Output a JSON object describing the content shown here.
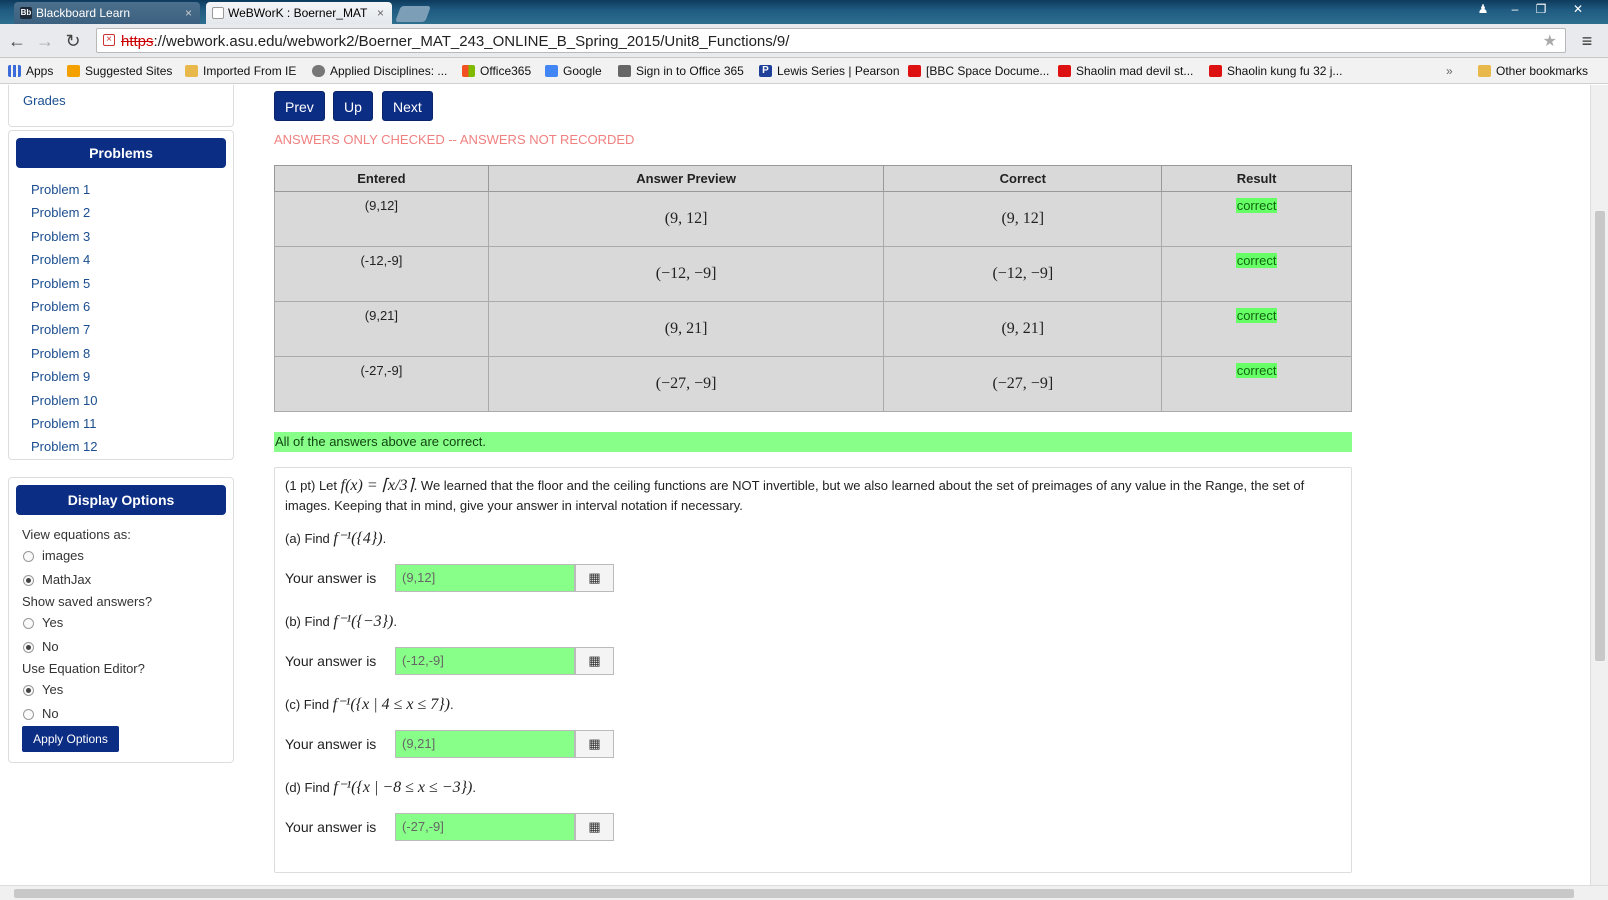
{
  "browser": {
    "tabs": [
      {
        "label": "Blackboard Learn",
        "close": "×"
      },
      {
        "label": "WeBWorK : Boerner_MAT",
        "close": "×"
      }
    ],
    "url_scheme": "https",
    "url_rest": "://webwork.asu.edu/webwork2/Boerner_MAT_243_ONLINE_B_Spring_2015/Unit8_Functions/9/",
    "bookmarks": [
      {
        "label": "Apps",
        "icon": "apps-grid-icon"
      },
      {
        "label": "Suggested Sites",
        "icon": "suggested-sites-icon"
      },
      {
        "label": "Imported From IE",
        "icon": "folder-icon"
      },
      {
        "label": "Applied Disciplines: ...",
        "icon": "site-icon"
      },
      {
        "label": "Office365",
        "icon": "office-icon"
      },
      {
        "label": "Google",
        "icon": "google-icon"
      },
      {
        "label": "Sign in to Office 365",
        "icon": "sign-in-icon"
      },
      {
        "label": "Lewis Series | Pearson",
        "icon": "pearson-icon"
      },
      {
        "label": "[BBC Space Docume...",
        "icon": "youtube-icon"
      },
      {
        "label": "Shaolin mad devil st...",
        "icon": "youtube-icon"
      },
      {
        "label": "Shaolin kung fu 32 j...",
        "icon": "youtube-icon"
      }
    ],
    "overflow": "»",
    "other_bookmarks": "Other bookmarks"
  },
  "sidebar": {
    "grades_link": "Grades",
    "problems_header": "Problems",
    "problems": [
      "Problem 1",
      "Problem 2",
      "Problem 3",
      "Problem 4",
      "Problem 5",
      "Problem 6",
      "Problem 7",
      "Problem 8",
      "Problem 9",
      "Problem 10",
      "Problem 11",
      "Problem 12"
    ],
    "display_header": "Display Options",
    "view_equations_label": "View equations as:",
    "view_opt_images": "images",
    "view_opt_mathjax": "MathJax",
    "view_selected": "MathJax",
    "show_saved_label": "Show saved answers?",
    "saved_yes": "Yes",
    "saved_no": "No",
    "saved_selected": "No",
    "eq_editor_label": "Use Equation Editor?",
    "editor_yes": "Yes",
    "editor_no": "No",
    "editor_selected": "Yes",
    "apply_button": "Apply Options"
  },
  "nav": {
    "prev": "Prev",
    "up": "Up",
    "next": "Next"
  },
  "status_message": "ANSWERS ONLY CHECKED -- ANSWERS NOT RECORDED",
  "results": {
    "headers": [
      "Entered",
      "Answer Preview",
      "Correct",
      "Result"
    ],
    "rows": [
      {
        "entered": "(9,12]",
        "preview": "(9, 12]",
        "correct": "(9, 12]",
        "result": "correct"
      },
      {
        "entered": "(-12,-9]",
        "preview": "(−12, −9]",
        "correct": "(−12, −9]",
        "result": "correct"
      },
      {
        "entered": "(9,21]",
        "preview": "(9, 21]",
        "correct": "(9, 21]",
        "result": "correct"
      },
      {
        "entered": "(-27,-9]",
        "preview": "(−27, −9]",
        "correct": "(−27, −9]",
        "result": "correct"
      }
    ]
  },
  "all_correct_message": "All of the answers above are correct.",
  "problem": {
    "intro_prefix": "(1 pt) Let",
    "intro_math": "f(x) = ⌈x/3⌉",
    "intro_text": ". We learned that the floor and the ceiling functions are NOT invertible, but we also learned about the set of preimages of any value in the Range, the set of images. Keeping that in mind, give your answer in interval notation if necessary.",
    "parts": [
      {
        "label": "(a) Find",
        "math": "f⁻¹({4})",
        "answer": "(9,12]"
      },
      {
        "label": "(b) Find",
        "math": "f⁻¹({−3})",
        "answer": "(-12,-9]"
      },
      {
        "label": "(c) Find",
        "math": "f⁻¹({x | 4 ≤ x ≤ 7})",
        "answer": "(9,21]"
      },
      {
        "label": "(d) Find",
        "math": "f⁻¹({x | −8 ≤ x ≤ −3})",
        "answer": "(-27,-9]"
      }
    ],
    "answer_prompt": "Your answer is",
    "editor_icon": "▦"
  },
  "colors": {
    "accent": "#0c2d84",
    "correct_bg": "#88ff88",
    "warning_text": "#f08080"
  }
}
